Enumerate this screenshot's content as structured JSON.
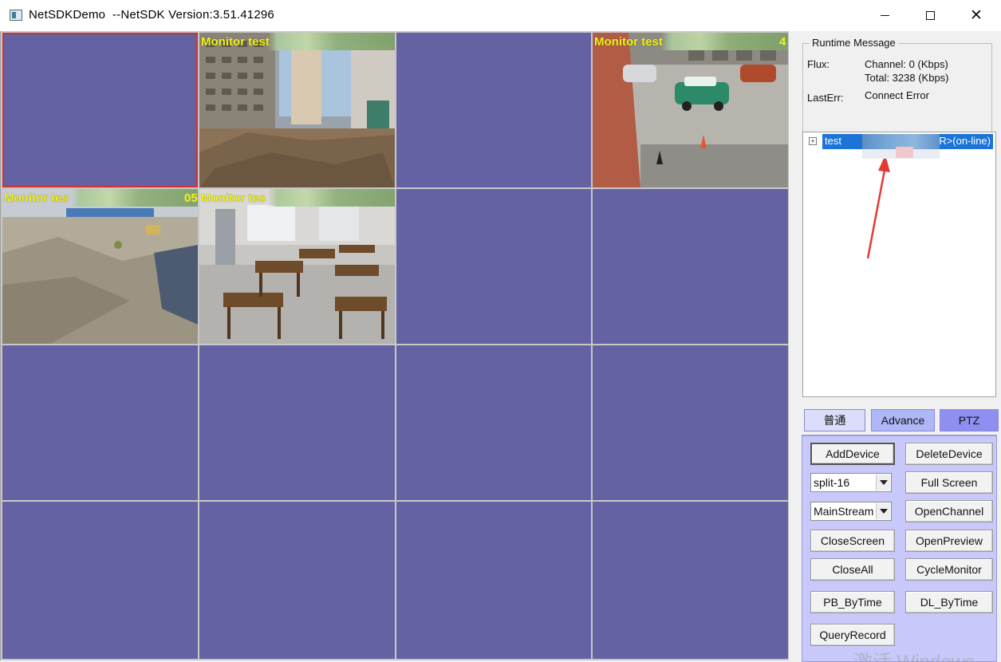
{
  "window": {
    "title": "NetSDKDemo  --NetSDK Version:3.51.41296",
    "minimize_icon": "minimize-icon",
    "maximize_icon": "maximize-icon",
    "close_icon": "close-icon"
  },
  "video_grid": {
    "split": 16,
    "cells": [
      {
        "title": "",
        "suffix": "",
        "has_video": false,
        "selected": true
      },
      {
        "title": "Monitor test",
        "suffix": "",
        "has_video": true,
        "selected": false
      },
      {
        "title": "",
        "suffix": "",
        "has_video": false,
        "selected": false
      },
      {
        "title": "Monitor test",
        "suffix": "4",
        "has_video": true,
        "selected": false
      },
      {
        "title": "Monitor tes",
        "suffix": "05",
        "has_video": true,
        "selected": false
      },
      {
        "title": "Monitor tes",
        "suffix": "",
        "has_video": true,
        "selected": false
      },
      {
        "title": "",
        "suffix": "",
        "has_video": false,
        "selected": false
      },
      {
        "title": "",
        "suffix": "",
        "has_video": false,
        "selected": false
      },
      {
        "title": "",
        "suffix": "",
        "has_video": false,
        "selected": false
      },
      {
        "title": "",
        "suffix": "",
        "has_video": false,
        "selected": false
      },
      {
        "title": "",
        "suffix": "",
        "has_video": false,
        "selected": false
      },
      {
        "title": "",
        "suffix": "",
        "has_video": false,
        "selected": false
      },
      {
        "title": "",
        "suffix": "",
        "has_video": false,
        "selected": false
      },
      {
        "title": "",
        "suffix": "",
        "has_video": false,
        "selected": false
      },
      {
        "title": "",
        "suffix": "",
        "has_video": false,
        "selected": false
      },
      {
        "title": "",
        "suffix": "",
        "has_video": false,
        "selected": false
      }
    ]
  },
  "runtime": {
    "group_title": "Runtime Message",
    "flux_label": "Flux:",
    "channel_value": "Channel: 0 (Kbps)",
    "total_value": "Total: 3238 (Kbps)",
    "lasterr_label": "LastErr:",
    "lasterr_value": "Connect Error"
  },
  "device_tree": {
    "node_prefix": "test",
    "node_suffix": "<NVR>(on-line)",
    "expander": "+"
  },
  "tabs": {
    "normal": "普通",
    "advance": "Advance",
    "ptz": "PTZ"
  },
  "buttons": {
    "add_device": "AddDevice",
    "delete_device": "DeleteDevice",
    "full_screen": "Full Screen",
    "open_channel": "OpenChannel",
    "close_screen": "CloseScreen",
    "open_preview": "OpenPreview",
    "close_all": "CloseAll",
    "cycle_monitor": "CycleMonitor",
    "pb_by_time": "PB_ByTime",
    "dl_by_time": "DL_ByTime",
    "query_record": "QueryRecord"
  },
  "selects": {
    "split_selected": "split-16",
    "stream_selected": "MainStream"
  },
  "colors": {
    "cell_bg": "#6562a3",
    "title_yellow": "#f2f21a",
    "tree_selection": "#1c73d8",
    "annotation_arrow": "#e53935",
    "tab_panel": "#c8c8fa"
  },
  "watermark": "激活 Windows"
}
